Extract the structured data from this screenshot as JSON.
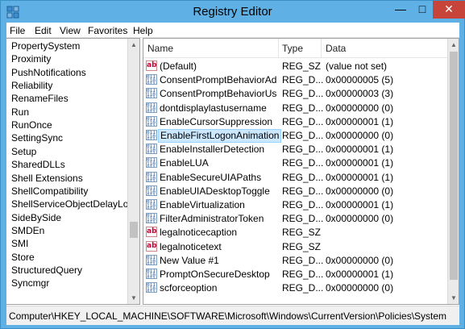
{
  "window": {
    "title": "Registry Editor",
    "minimize": "—",
    "maximize": "□",
    "close": "✕"
  },
  "menu": [
    "File",
    "Edit",
    "View",
    "Favorites",
    "Help"
  ],
  "tree": {
    "items": [
      "PropertySystem",
      "Proximity",
      "PushNotifications",
      "Reliability",
      "RenameFiles",
      "Run",
      "RunOnce",
      "SettingSync",
      "Setup",
      "SharedDLLs",
      "Shell Extensions",
      "ShellCompatibility",
      "ShellServiceObjectDelayLoad",
      "SideBySide",
      "SMDEn",
      "SMI",
      "Store",
      "StructuredQuery",
      "Syncmgr"
    ]
  },
  "list": {
    "columns": {
      "name": "Name",
      "type": "Type",
      "data": "Data"
    },
    "rows": [
      {
        "icon": "string-value-icon",
        "name": "(Default)",
        "type": "REG_SZ",
        "data": "(value not set)"
      },
      {
        "icon": "binary-value-icon",
        "name": "ConsentPromptBehaviorAd...",
        "type": "REG_D...",
        "data": "0x00000005 (5)"
      },
      {
        "icon": "binary-value-icon",
        "name": "ConsentPromptBehaviorUser",
        "type": "REG_D...",
        "data": "0x00000003 (3)"
      },
      {
        "icon": "binary-value-icon",
        "name": "dontdisplaylastusername",
        "type": "REG_D...",
        "data": "0x00000000 (0)"
      },
      {
        "icon": "binary-value-icon",
        "name": "EnableCursorSuppression",
        "type": "REG_D...",
        "data": "0x00000001 (1)"
      },
      {
        "icon": "binary-value-icon",
        "name": "EnableFirstLogonAnimation",
        "type": "REG_D...",
        "data": "0x00000000 (0)",
        "selected": true
      },
      {
        "icon": "binary-value-icon",
        "name": "EnableInstallerDetection",
        "type": "REG_D...",
        "data": "0x00000001 (1)"
      },
      {
        "icon": "binary-value-icon",
        "name": "EnableLUA",
        "type": "REG_D...",
        "data": "0x00000001 (1)"
      },
      {
        "icon": "binary-value-icon",
        "name": "EnableSecureUIAPaths",
        "type": "REG_D...",
        "data": "0x00000001 (1)"
      },
      {
        "icon": "binary-value-icon",
        "name": "EnableUIADesktopToggle",
        "type": "REG_D...",
        "data": "0x00000000 (0)"
      },
      {
        "icon": "binary-value-icon",
        "name": "EnableVirtualization",
        "type": "REG_D...",
        "data": "0x00000001 (1)"
      },
      {
        "icon": "binary-value-icon",
        "name": "FilterAdministratorToken",
        "type": "REG_D...",
        "data": "0x00000000 (0)"
      },
      {
        "icon": "string-value-icon",
        "name": "legalnoticecaption",
        "type": "REG_SZ",
        "data": ""
      },
      {
        "icon": "string-value-icon",
        "name": "legalnoticetext",
        "type": "REG_SZ",
        "data": ""
      },
      {
        "icon": "binary-value-icon",
        "name": "New Value #1",
        "type": "REG_D...",
        "data": "0x00000000 (0)"
      },
      {
        "icon": "binary-value-icon",
        "name": "PromptOnSecureDesktop",
        "type": "REG_D...",
        "data": "0x00000001 (1)"
      },
      {
        "icon": "binary-value-icon",
        "name": "scforceoption",
        "type": "REG_D...",
        "data": "0x00000000 (0)"
      }
    ]
  },
  "status": {
    "path": "Computer\\HKEY_LOCAL_MACHINE\\SOFTWARE\\Microsoft\\Windows\\CurrentVersion\\Policies\\System"
  },
  "colors": {
    "title_bar": "#5fb0e4",
    "close_button": "#c7443b",
    "selection": "#cce8ff"
  }
}
